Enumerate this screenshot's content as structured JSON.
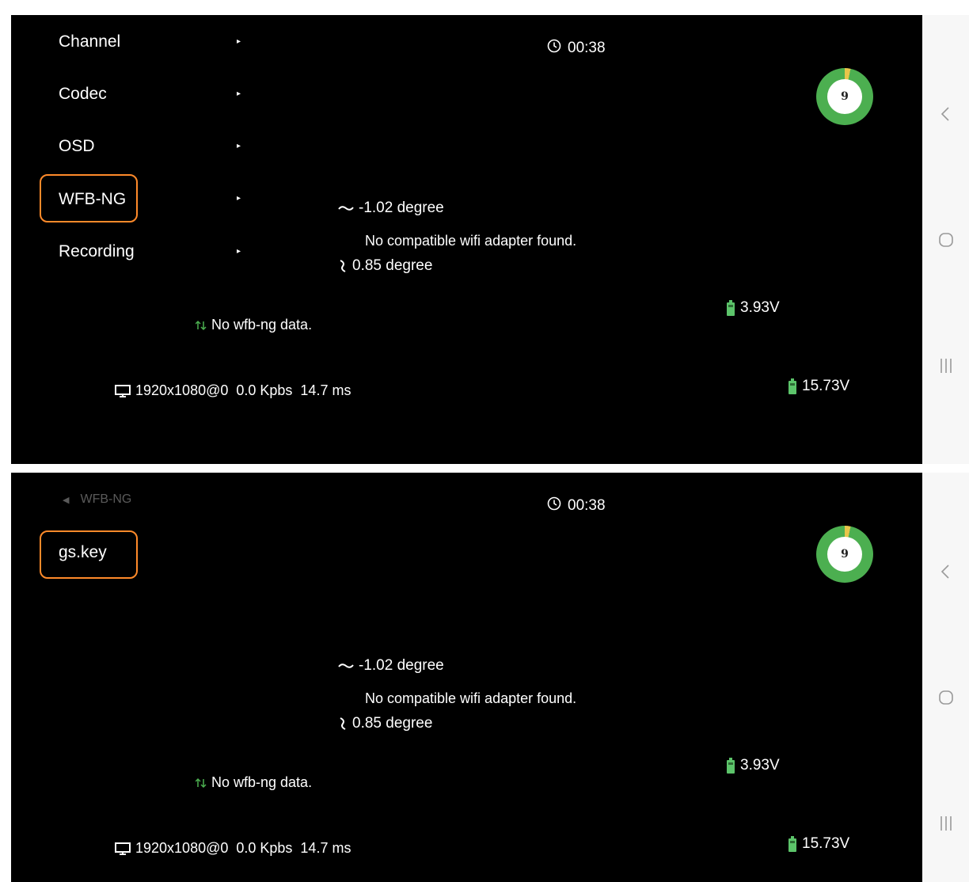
{
  "screen1": {
    "menu": [
      {
        "label": "Channel"
      },
      {
        "label": "Codec"
      },
      {
        "label": "OSD"
      },
      {
        "label": "WFB-NG"
      },
      {
        "label": "Recording"
      }
    ],
    "arrow": "▸",
    "timer": "00:38",
    "gauge_value": "9",
    "roll": "-1.02 degree",
    "wifi_message": "No compatible wifi adapter found.",
    "pitch": "0.85 degree",
    "cell_voltage": "3.93V",
    "wfb_status": "No wfb-ng data.",
    "video_stats": "1920x1080@0  0.0 Kpbs  14.7 ms",
    "pack_voltage": "15.73V"
  },
  "screen2": {
    "breadcrumb": "WFB-NG",
    "menu": [
      {
        "label": "gs.key"
      }
    ],
    "timer": "00:38",
    "gauge_value": "9",
    "roll": "-1.02 degree",
    "wifi_message": "No compatible wifi adapter found.",
    "pitch": "0.85 degree",
    "cell_voltage": "3.93V",
    "wfb_status": "No wfb-ng data.",
    "video_stats": "1920x1080@0  0.0 Kpbs  14.7 ms",
    "pack_voltage": "15.73V"
  },
  "colors": {
    "highlight": "#ff8a2a",
    "gauge_green": "#4caf50",
    "gauge_yellow": "#e8c54a",
    "battery_green": "#5cc46a",
    "background": "#000000",
    "navbar": "#f7f7f7"
  },
  "icons": [
    "clock-icon",
    "roll-icon",
    "pitch-icon",
    "battery-icon",
    "signal-icon",
    "monitor-icon",
    "back-icon",
    "home-icon",
    "recents-icon",
    "chevron-left-icon"
  ]
}
